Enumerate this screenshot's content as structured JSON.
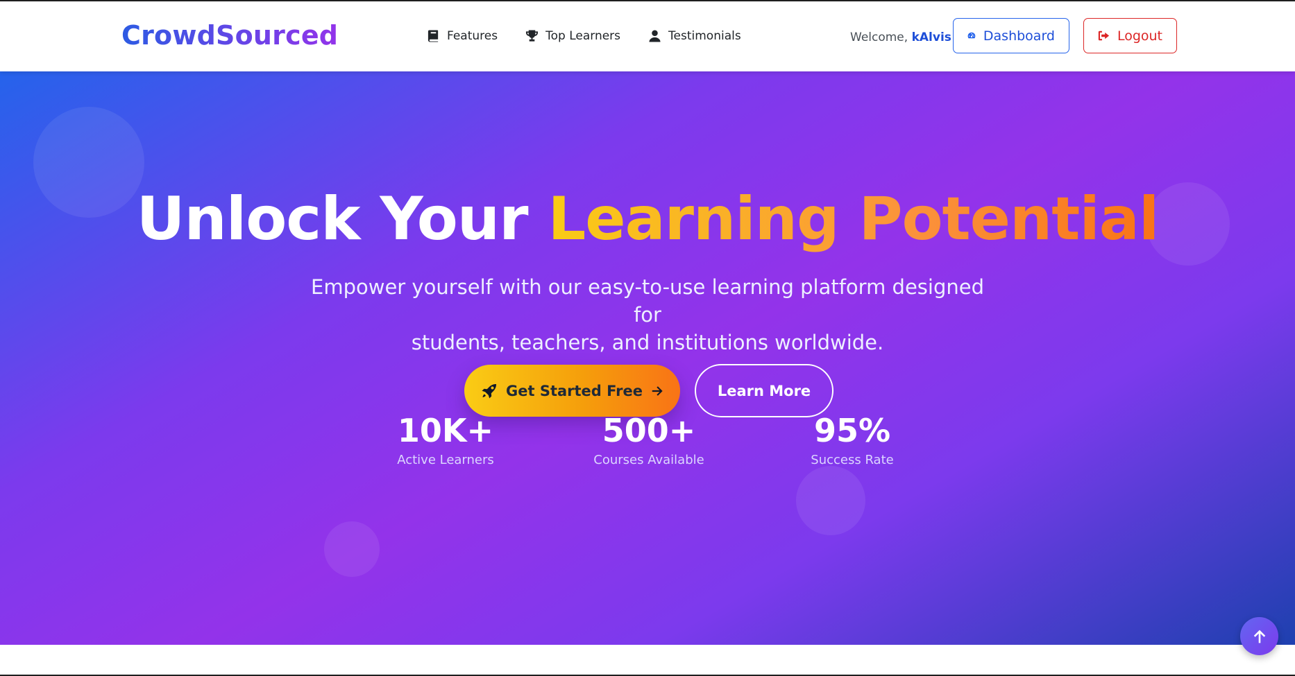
{
  "brand": {
    "name": "CrowdSourced"
  },
  "nav": {
    "links": [
      {
        "label": "Features",
        "icon": "book-icon"
      },
      {
        "label": "Top Learners",
        "icon": "trophy-icon"
      },
      {
        "label": "Testimonials",
        "icon": "user-icon"
      }
    ],
    "welcome_prefix": "Welcome,",
    "username": "kAlvis",
    "dashboard_label": "Dashboard",
    "logout_label": "Logout"
  },
  "hero": {
    "headline_plain": "Unlock Your ",
    "headline_accent": "Learning Potential",
    "subtitle_line1": "Empower yourself with our easy-to-use learning platform designed for",
    "subtitle_line2": "students, teachers, and institutions worldwide.",
    "primary_cta": "Get Started Free",
    "secondary_cta": "Learn More",
    "stats": [
      {
        "value": "10K+",
        "label": "Active Learners"
      },
      {
        "value": "500+",
        "label": "Courses Available"
      },
      {
        "value": "95%",
        "label": "Success Rate"
      }
    ]
  },
  "colors": {
    "brand_gradient_start": "#2d5be3",
    "brand_gradient_end": "#9333ea",
    "hero_blue": "#2563eb",
    "hero_purple": "#9333ea",
    "accent_yellow": "#facc15",
    "accent_orange": "#f97316",
    "dashboard_blue": "#2563eb",
    "logout_red": "#dc2626"
  },
  "icons": {
    "dashboard": "tachometer-icon",
    "logout": "sign-out-icon",
    "primary_cta": "rocket-icon",
    "primary_cta_trailing": "arrow-right-icon",
    "scroll_top": "arrow-up-icon"
  }
}
